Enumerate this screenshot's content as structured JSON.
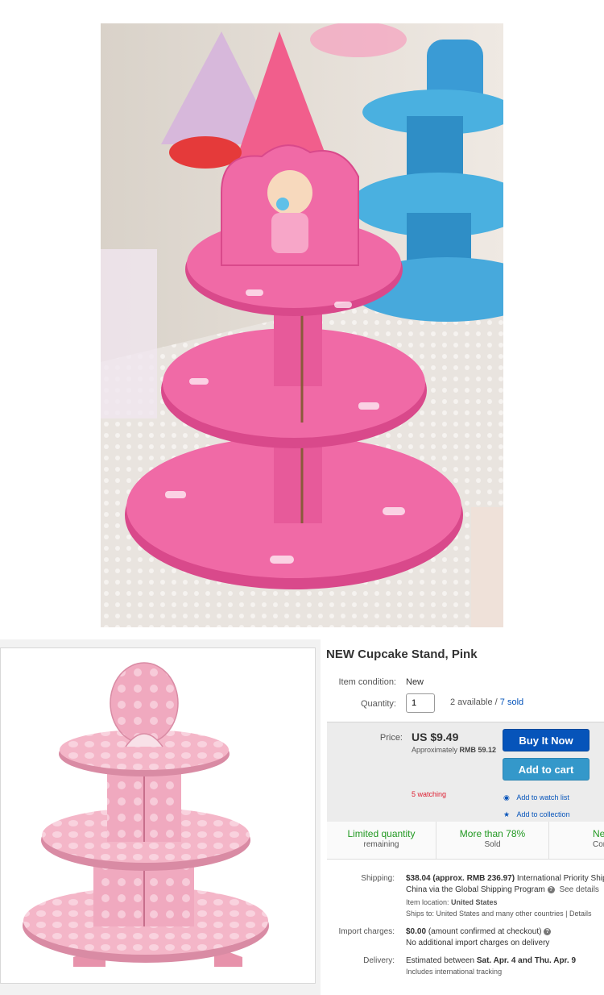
{
  "listing": {
    "title": "NEW Cupcake Stand, Pink",
    "condition_label": "Item condition:",
    "condition_value": "New",
    "quantity_label": "Quantity:",
    "quantity_value": "1",
    "available_text": "2 available /",
    "sold_text": "7 sold",
    "price_label": "Price:",
    "price": "US $9.49",
    "approx_label": "Approximately",
    "approx_value": "RMB 59.12",
    "buy_now": "Buy It Now",
    "add_to_cart": "Add to cart",
    "watching": "5 watching",
    "add_watch": "Add to watch list",
    "add_collection": "Add to collection",
    "badges": [
      {
        "title": "Limited quantity",
        "sub": "remaining"
      },
      {
        "title": "More than 78%",
        "sub": "Sold"
      },
      {
        "title": "New",
        "sub": "Condition"
      }
    ],
    "shipping_label": "Shipping:",
    "shipping_price": "$38.04 (approx. RMB 236.97)",
    "shipping_method": "International Priority Shipping",
    "shipping_line2": "China via the Global Shipping Program",
    "see_details": "See details",
    "item_location_label": "Item location:",
    "item_location": "United States",
    "ships_to": "Ships to: United States and many other countries | Details",
    "import_label": "Import charges:",
    "import_value": "$0.00",
    "import_note": "(amount confirmed at checkout)",
    "import_line2": "No additional import charges on delivery",
    "delivery_label": "Delivery:",
    "delivery_text": "Estimated between",
    "delivery_dates": "Sat. Apr. 4 and Thu. Apr. 9",
    "delivery_line2": "Includes international tracking"
  },
  "colors": {
    "ebay_blue": "#0654ba",
    "cart_blue": "#3498ca",
    "watch_red": "#dd1e31",
    "badge_green": "#229922",
    "pink": "#e8609a"
  }
}
